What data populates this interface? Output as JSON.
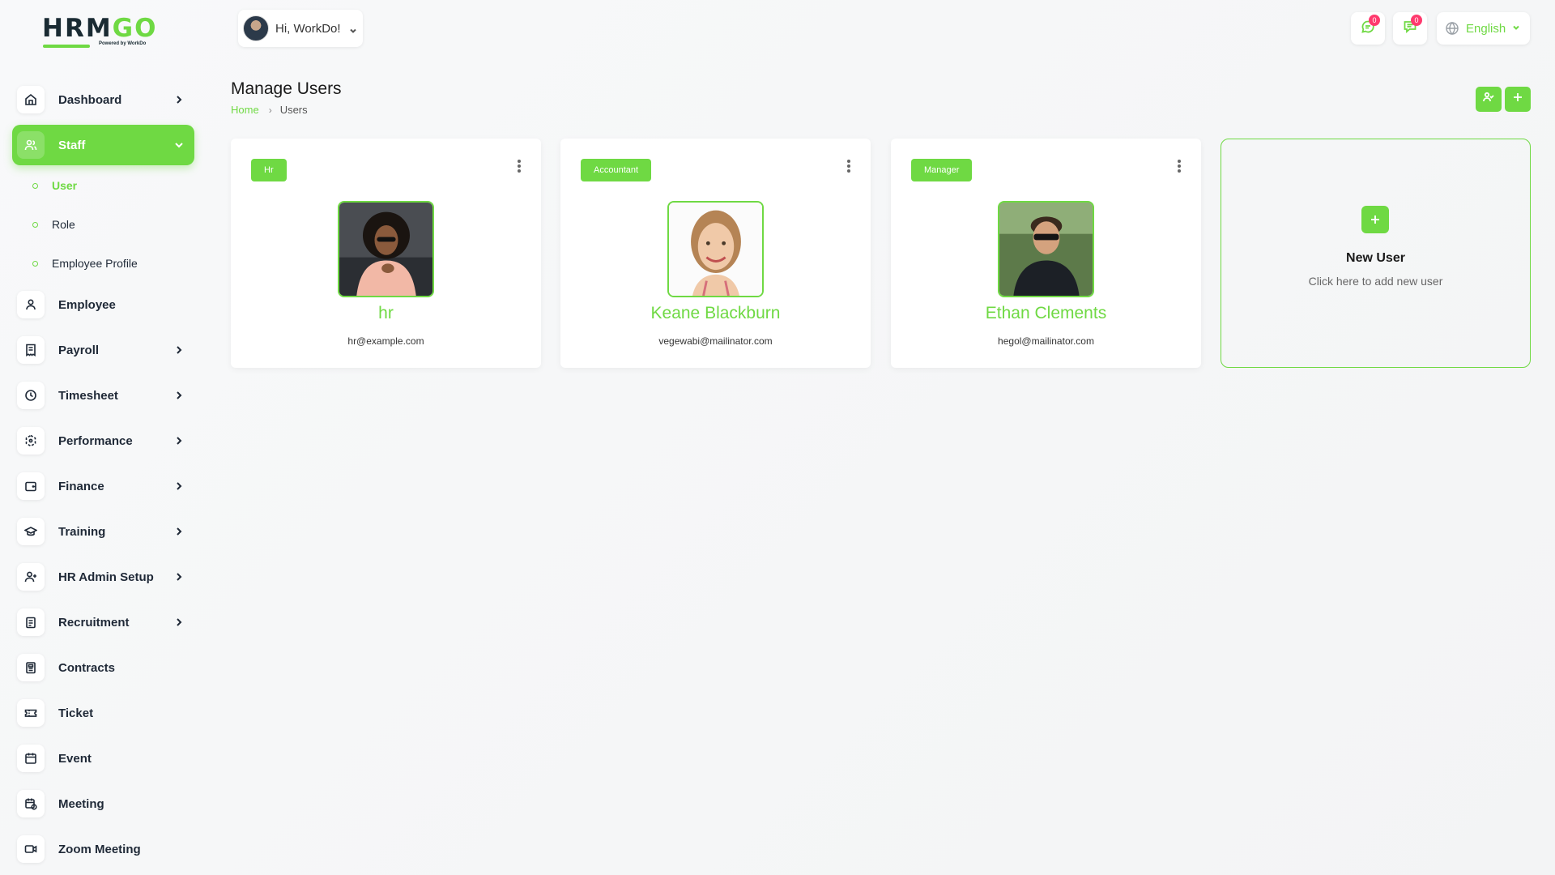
{
  "app": {
    "logo_text_dark": "HRM",
    "logo_text_accent": "GO",
    "logo_powered": "Powered by WorkDo"
  },
  "header": {
    "greeting": "Hi, WorkDo!",
    "messages_badge": "0",
    "chat_badge": "0",
    "language": "English"
  },
  "sidebar": {
    "items": [
      {
        "label": "Dashboard"
      },
      {
        "label": "Staff"
      },
      {
        "label": "Employee"
      },
      {
        "label": "Payroll"
      },
      {
        "label": "Timesheet"
      },
      {
        "label": "Performance"
      },
      {
        "label": "Finance"
      },
      {
        "label": "Training"
      },
      {
        "label": "HR Admin Setup"
      },
      {
        "label": "Recruitment"
      },
      {
        "label": "Contracts"
      },
      {
        "label": "Ticket"
      },
      {
        "label": "Event"
      },
      {
        "label": "Meeting"
      },
      {
        "label": "Zoom Meeting"
      }
    ],
    "staff_sub": [
      {
        "label": "User"
      },
      {
        "label": "Role"
      },
      {
        "label": "Employee Profile"
      }
    ]
  },
  "page": {
    "title": "Manage Users",
    "breadcrumb_home": "Home",
    "breadcrumb_current": "Users"
  },
  "users": [
    {
      "role": "Hr",
      "name": "hr",
      "email": "hr@example.com"
    },
    {
      "role": "Accountant",
      "name": "Keane Blackburn",
      "email": "vegewabi@mailinator.com"
    },
    {
      "role": "Manager",
      "name": "Ethan Clements",
      "email": "hegol@mailinator.com"
    }
  ],
  "new_user": {
    "title": "New User",
    "subtitle": "Click here to add new user"
  },
  "colors": {
    "accent": "#6fd943",
    "badge": "#ff3a6e"
  }
}
